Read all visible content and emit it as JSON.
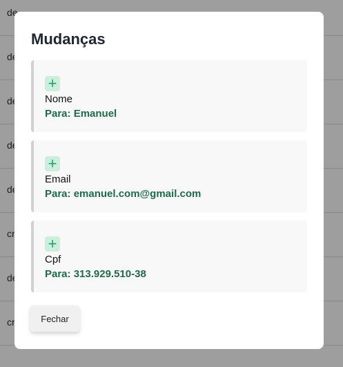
{
  "background": {
    "rows": [
      {
        "text": "de"
      },
      {
        "text": "de"
      },
      {
        "text": "de"
      },
      {
        "text": "de"
      },
      {
        "text": "de"
      },
      {
        "text": "cr"
      },
      {
        "text": "de"
      },
      {
        "text": "cr"
      }
    ]
  },
  "modal": {
    "title": "Mudanças",
    "changes": [
      {
        "icon": "plus-icon",
        "field": "Nome",
        "change": "Para: Emanuel"
      },
      {
        "icon": "plus-icon",
        "field": "Email",
        "change": "Para: emanuel.com@gmail.com"
      },
      {
        "icon": "plus-icon",
        "field": "Cpf",
        "change": "Para: 313.929.510-38"
      }
    ],
    "close_label": "Fechar"
  }
}
